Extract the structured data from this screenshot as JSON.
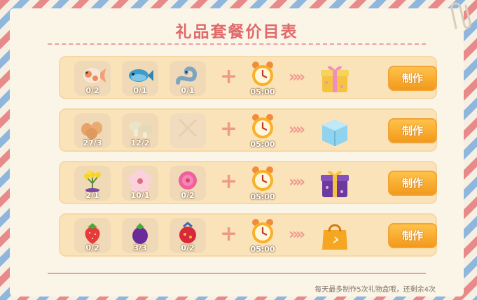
{
  "title": "礼品套餐价目表",
  "footer_note": "每天最多制作5次礼物盒哦，还剩余4次",
  "rows": [
    {
      "items": [
        {
          "icon": "koi-fish-icon",
          "count": "0/2"
        },
        {
          "icon": "blue-fish-icon",
          "count": "0/1"
        },
        {
          "icon": "eel-icon",
          "count": "0/1"
        }
      ],
      "time": "05:00",
      "gift_icon": "yellow-gift-box-icon",
      "button": "制作"
    },
    {
      "items": [
        {
          "icon": "eggs-icon",
          "count": "27/3"
        },
        {
          "icon": "mushrooms-icon",
          "count": "12/2"
        },
        {
          "icon": "empty-slot-icon",
          "count": ""
        }
      ],
      "time": "05:00",
      "gift_icon": "blue-gift-box-icon",
      "button": "制作"
    },
    {
      "items": [
        {
          "icon": "yellow-flower-icon",
          "count": "2/1"
        },
        {
          "icon": "pink-blossom-icon",
          "count": "10/1"
        },
        {
          "icon": "rose-icon",
          "count": "0/2"
        }
      ],
      "time": "05:00",
      "gift_icon": "purple-gift-box-icon",
      "button": "制作"
    },
    {
      "items": [
        {
          "icon": "strawberry-icon",
          "count": "0/2"
        },
        {
          "icon": "eggplant-icon",
          "count": "3/3"
        },
        {
          "icon": "red-lantern-fruit-icon",
          "count": "0/2"
        }
      ],
      "time": "05:00",
      "gift_icon": "orange-gift-bag-icon",
      "button": "制作"
    }
  ]
}
